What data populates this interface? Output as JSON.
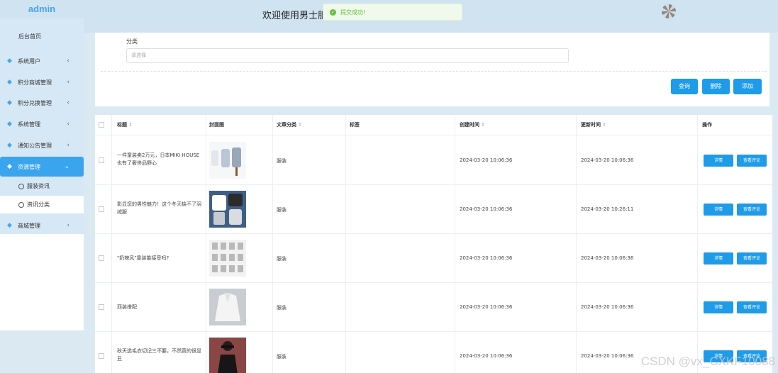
{
  "header": {
    "brand": "admin",
    "welcome": "欢迎使用男士服装",
    "toast": "提交成功!"
  },
  "sidebar": {
    "home": "后台首页",
    "items": [
      {
        "label": "系统用户"
      },
      {
        "label": "积分商城管理"
      },
      {
        "label": "积分兑换管理"
      },
      {
        "label": "系统管理"
      },
      {
        "label": "通知公告管理"
      },
      {
        "label": "资源管理"
      },
      {
        "label": "商城管理"
      }
    ],
    "subitems": [
      "服装资讯",
      "资讯分类"
    ]
  },
  "filter": {
    "label": "分类",
    "placeholder": "请选择",
    "query": "查询",
    "delete": "删除",
    "add": "添加"
  },
  "table": {
    "headers": [
      "标题",
      "封面图",
      "文章分类",
      "标签",
      "创建时间",
      "更新时间",
      "操作"
    ],
    "detail": "详情",
    "comments": "查看评论",
    "rows": [
      {
        "title": "一件童装卖2万元，日本MIKI HOUSE也有了奢侈品野心",
        "category": "服装",
        "tag": "",
        "created": "2024-03-20 10:06:36",
        "updated": "2024-03-20 10:06:36",
        "cover": "#eef1f5"
      },
      {
        "title": "彰显您的男性魅力！这个冬天缺不了羽绒服",
        "category": "服装",
        "tag": "",
        "created": "2024-03-20 10:06:36",
        "updated": "2024-03-20 10:26:11",
        "cover": "#3f5f86"
      },
      {
        "title": "\"奶辣风\"童装能接受吗?",
        "category": "服装",
        "tag": "",
        "created": "2024-03-20 10:06:36",
        "updated": "2024-03-20 10:06:36",
        "cover": "#e7e7e7"
      },
      {
        "title": "西装搭配",
        "category": "服装",
        "tag": "",
        "created": "2024-03-20 10:06:36",
        "updated": "2024-03-20 10:06:36",
        "cover": "#c9cdd2"
      },
      {
        "title": "秋天选毛衣切记三不要，不然真的很显丑",
        "category": "服装",
        "tag": "",
        "created": "2024-03-20 10:06:36",
        "updated": "2024-03-20 10:06:36",
        "cover": "#7a3b3b"
      }
    ]
  },
  "watermark": "CSDN @vx_CXKF10088"
}
